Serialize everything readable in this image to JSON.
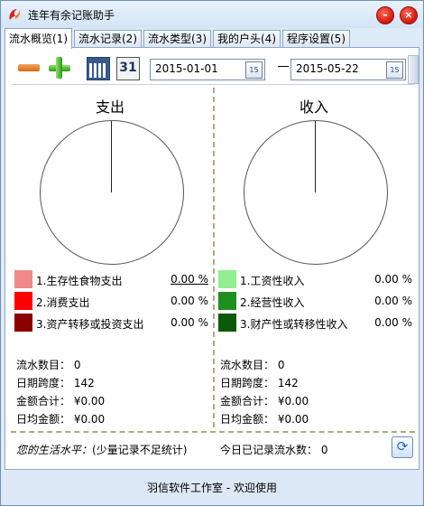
{
  "window": {
    "title": "连年有余记账助手",
    "minimize_glyph": "–",
    "close_glyph": "×"
  },
  "tabs": [
    {
      "label": "流水概览(1)",
      "active": true
    },
    {
      "label": "流水记录(2)",
      "active": false
    },
    {
      "label": "流水类型(3)",
      "active": false
    },
    {
      "label": "我的户头(4)",
      "active": false
    },
    {
      "label": "程序设置(5)",
      "active": false
    }
  ],
  "toolbar": {
    "calendar_day": "31",
    "start_date": "2015-01-01",
    "end_date": "2015-05-22",
    "date_button": "15",
    "icons": [
      "minus-icon",
      "plus-icon",
      "calendar-month-icon",
      "calendar-day-icon"
    ]
  },
  "expense": {
    "title": "支出",
    "legend": [
      {
        "label": "1.生存性食物支出",
        "percent": "0.00 %",
        "color": "#f08a8a"
      },
      {
        "label": "2.消费支出",
        "percent": "0.00 %",
        "color": "#ff0000"
      },
      {
        "label": "3.资产转移或投资支出",
        "percent": "0.00 %",
        "color": "#8b0000"
      }
    ],
    "stats": {
      "count": "流水数目： 0",
      "span": "日期跨度： 142",
      "total": "金额合计： ¥0.00",
      "daily": "日均金额： ¥0.00"
    }
  },
  "income": {
    "title": "收入",
    "legend": [
      {
        "label": "1.工资性收入",
        "percent": "0.00 %",
        "color": "#90ee90"
      },
      {
        "label": "2.经营性收入",
        "percent": "0.00 %",
        "color": "#1f8f1f"
      },
      {
        "label": "3.财产性或转移性收入",
        "percent": "0.00 %",
        "color": "#0b5a0b"
      }
    ],
    "stats": {
      "count": "流水数目： 0",
      "span": "日期跨度： 142",
      "total": "金额合计： ¥0.00",
      "daily": "日均金额： ¥0.00"
    }
  },
  "footer": {
    "level_label": "您的生活水平：",
    "level_value": "(少量记录不足统计)",
    "today": "今日已记录流水数： 0",
    "status": "羽信软件工作室 - 欢迎使用"
  }
}
